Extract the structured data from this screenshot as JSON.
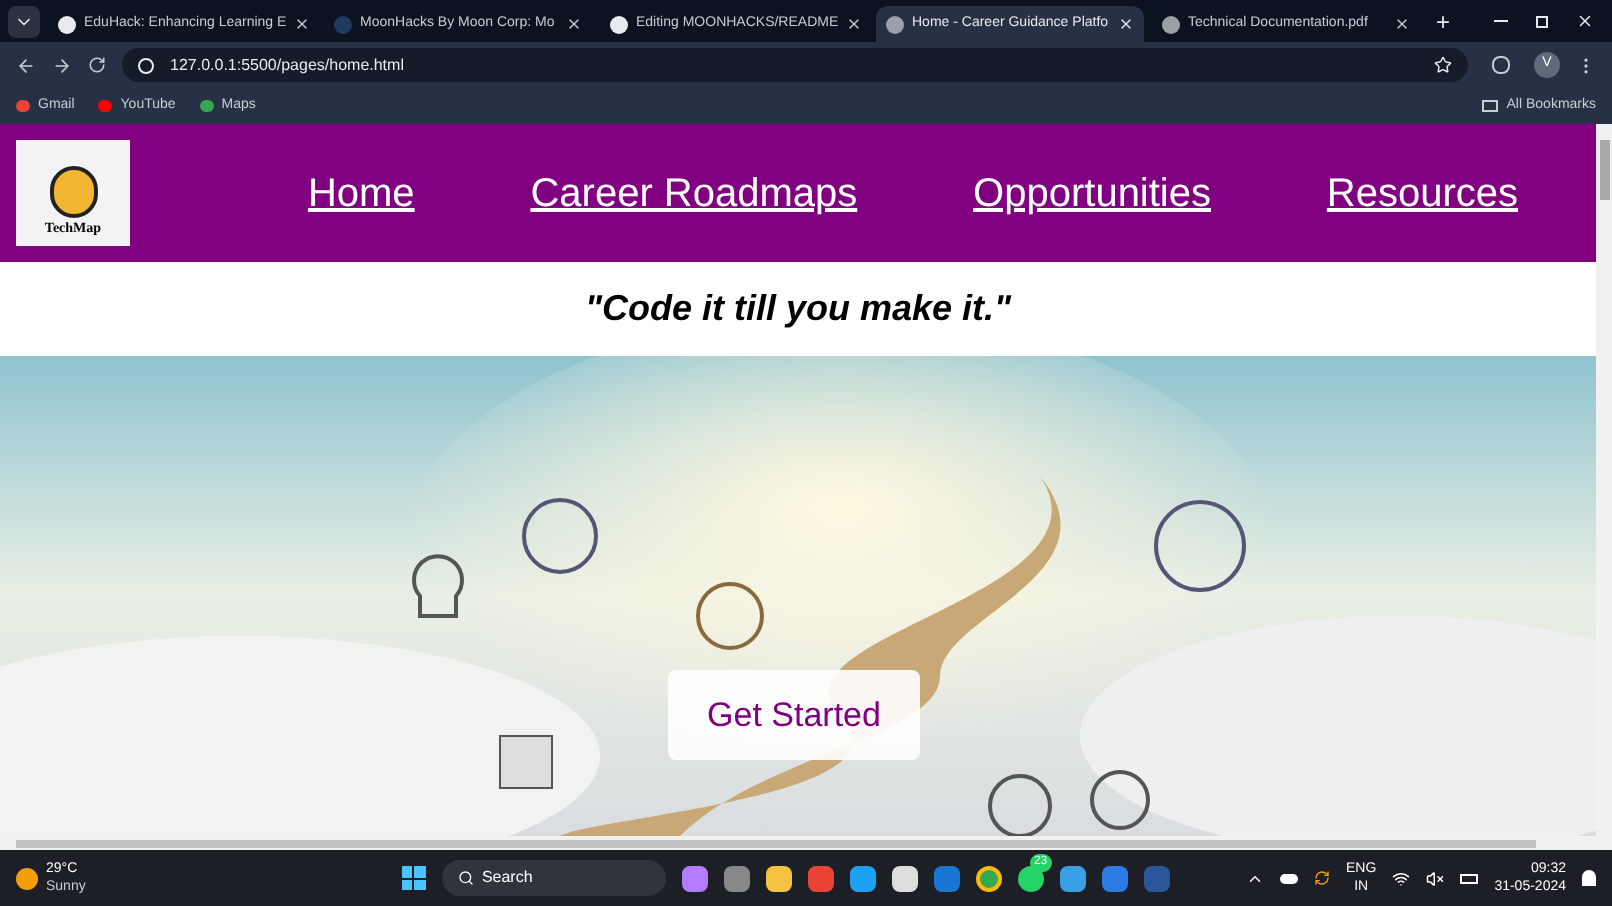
{
  "browser": {
    "tabs": [
      {
        "title": "EduHack: Enhancing Learning E",
        "selected": false
      },
      {
        "title": "MoonHacks By Moon Corp: Mo",
        "selected": false
      },
      {
        "title": "Editing MOONHACKS/README",
        "selected": false
      },
      {
        "title": "Home - Career Guidance Platfo",
        "selected": true
      },
      {
        "title": "Technical Documentation.pdf",
        "selected": false
      }
    ],
    "new_tab": "+",
    "address": "127.0.0.1:5500/pages/home.html",
    "bookmarks": [
      "Gmail",
      "YouTube",
      "Maps"
    ],
    "all_bookmarks": "All Bookmarks",
    "profile": "V"
  },
  "page": {
    "logo_text": "TechMap",
    "nav": [
      "Home",
      "Career Roadmaps",
      "Opportunities",
      "Resources"
    ],
    "quote": "\"Code it till you make it.\"",
    "cta": "Get Started"
  },
  "taskbar": {
    "temperature": "29°C",
    "weather": "Sunny",
    "search": "Search",
    "badge": "23",
    "lang": "ENG",
    "region": "IN",
    "time": "09:32",
    "date": "31-05-2024"
  }
}
